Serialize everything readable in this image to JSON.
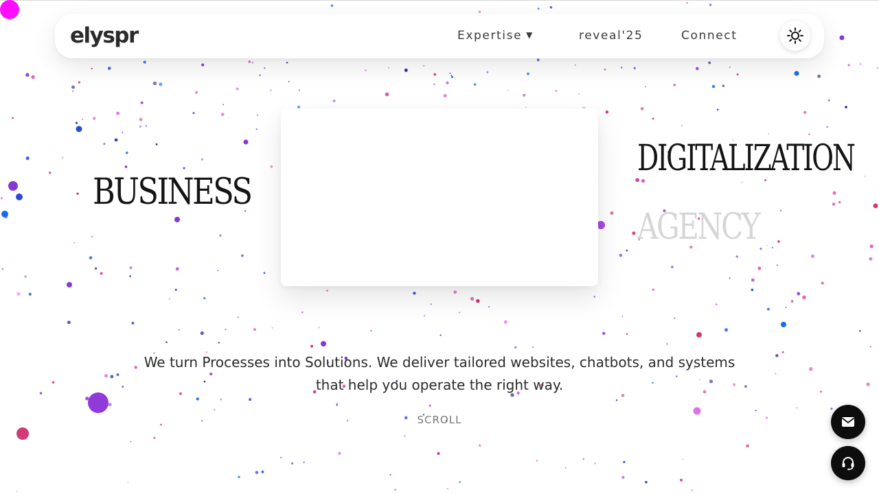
{
  "brand": {
    "logo_text": "elyspr"
  },
  "nav": {
    "items": [
      {
        "label": "Expertise",
        "has_dropdown": true
      },
      {
        "label": "reveal'25"
      },
      {
        "label": "Connect"
      }
    ],
    "theme_toggle_icon": "sun-icon",
    "dropdown_icon": "caret-down-icon"
  },
  "hero": {
    "words": {
      "left": "BUSINESS",
      "right_top": "DIGITALIZATION",
      "right_bottom": "AGENCY"
    },
    "tagline": "We turn Processes into Solutions. We deliver tailored websites, chatbots, and systems that help you operate the right way.",
    "scroll_label": "SCROLL"
  },
  "floating_actions": [
    {
      "icon": "mail-icon"
    },
    {
      "icon": "headset-icon"
    }
  ],
  "colors": {
    "particles": [
      "#1e3fd8",
      "#0a64f0",
      "#7d2fd0",
      "#a33fe0",
      "#c83aa0",
      "#e05ab8",
      "#cc2f6e",
      "#d86fe0",
      "#1f1f8a"
    ],
    "accent_corner": "#ff00ff",
    "text_dark": "#141414",
    "text_faded": "#d6d6d6",
    "fab_bg": "#0d0d0d"
  }
}
